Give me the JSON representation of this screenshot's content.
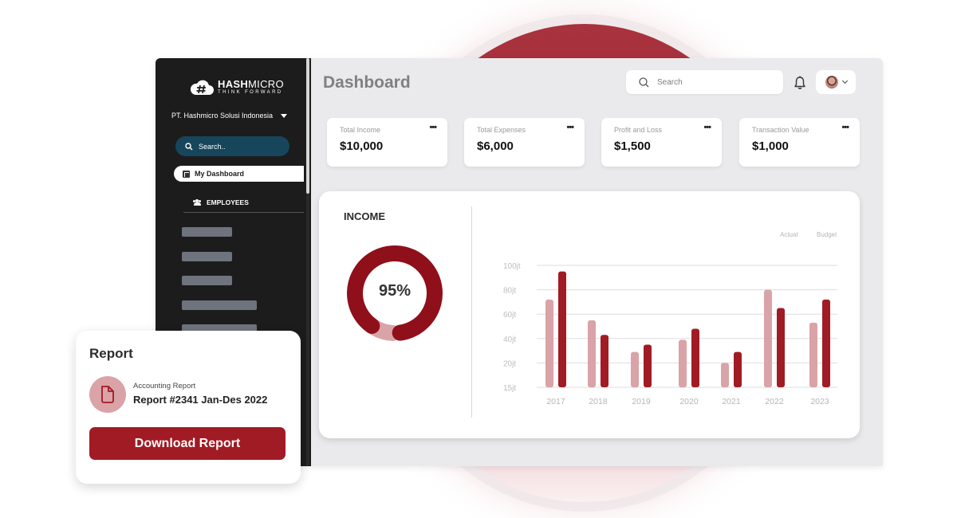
{
  "brand": {
    "name_bold": "HASH",
    "name_light": "MICRO",
    "tagline": "THINK FORWARD",
    "accent": "#a11b24",
    "accent_light": "#d9a3a7"
  },
  "sidebar": {
    "company": "PT. Hashmicro Solusi Indonesia",
    "search_placeholder": "Search..",
    "items": [
      {
        "label": "My Dashboard",
        "icon": "dashboard-icon",
        "active": true
      },
      {
        "label": "EMPLOYEES",
        "icon": "people-icon",
        "active": false
      }
    ]
  },
  "header": {
    "title": "Dashboard",
    "search_placeholder": "Search",
    "notification_icon": "bell-icon",
    "profile_icon": "avatar"
  },
  "kpis": [
    {
      "label": "Total Income",
      "value": "$10,000",
      "menu": "•••"
    },
    {
      "label": "Total Expenses",
      "value": "$6,000",
      "menu": "•••"
    },
    {
      "label": "Profit and Loss",
      "value": "$1,500",
      "menu": "•••"
    },
    {
      "label": "Transaction Value",
      "value": "$1,000",
      "menu": "•••"
    }
  ],
  "income": {
    "title": "INCOME",
    "percent_label": "95%",
    "percent": 95
  },
  "chart_data": {
    "type": "bar",
    "title": "INCOME",
    "categories": [
      "2017",
      "2018",
      "2019",
      "2020",
      "2021",
      "2022",
      "2023"
    ],
    "series": [
      {
        "name": "Actual",
        "color": "#d9a3a7",
        "values": [
          72,
          55,
          29,
          39,
          20,
          80,
          53
        ]
      },
      {
        "name": "Budget",
        "color": "#a11b24",
        "values": [
          95,
          43,
          35,
          48,
          29,
          65,
          72
        ]
      }
    ],
    "yticks": [
      15,
      20,
      40,
      60,
      80,
      100
    ],
    "ytick_labels": [
      "15jt",
      "20jt",
      "40jt",
      "60jt",
      "80jt",
      "100jt"
    ],
    "ylim": [
      15,
      100
    ],
    "xlabel": "",
    "ylabel": "",
    "grid": true,
    "legend": "top-right"
  },
  "report": {
    "title": "Report",
    "subtitle": "Accounting Report",
    "name": "Report #2341 Jan-Des 2022",
    "button_label": "Download Report"
  }
}
